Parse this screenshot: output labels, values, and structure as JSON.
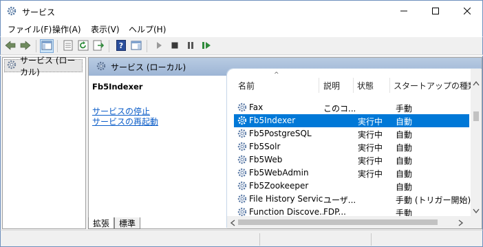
{
  "window": {
    "title": "サービス",
    "icon": "gear-icon",
    "controls": [
      "minimize-icon",
      "maximize-icon",
      "close-icon"
    ]
  },
  "menu": {
    "items": [
      {
        "label": "ファイル(F)"
      },
      {
        "label": "操作(A)"
      },
      {
        "label": "表示(V)"
      },
      {
        "label": "ヘルプ(H)"
      }
    ]
  },
  "toolbar": {
    "icons": [
      "back-icon",
      "forward-icon",
      "show-console-tree-icon",
      "properties-icon",
      "refresh-icon",
      "export-list-icon",
      "help-icon",
      "show-action-pane-icon",
      "play-icon",
      "stop-icon",
      "pause-icon",
      "restart-icon"
    ]
  },
  "tree": {
    "item_label": "サービス (ローカル)"
  },
  "pane": {
    "header": "サービス (ローカル)",
    "selected_service": "Fb5Indexer",
    "link_stop": "サービスの停止",
    "link_restart": "サービスの再起動"
  },
  "list": {
    "columns": [
      "名前",
      "説明",
      "状態",
      "スタートアップの種類"
    ],
    "rows": [
      {
        "name": "Fax",
        "desc": "このコ...",
        "state": "",
        "startup": "手動",
        "selected": false
      },
      {
        "name": "Fb5Indexer",
        "desc": "",
        "state": "実行中",
        "startup": "自動",
        "selected": true
      },
      {
        "name": "Fb5PostgreSQL",
        "desc": "",
        "state": "実行中",
        "startup": "自動",
        "selected": false
      },
      {
        "name": "Fb5Solr",
        "desc": "",
        "state": "実行中",
        "startup": "自動",
        "selected": false
      },
      {
        "name": "Fb5Web",
        "desc": "",
        "state": "実行中",
        "startup": "自動",
        "selected": false
      },
      {
        "name": "Fb5WebAdmin",
        "desc": "",
        "state": "実行中",
        "startup": "自動",
        "selected": false
      },
      {
        "name": "Fb5Zookeeper",
        "desc": "",
        "state": "",
        "startup": "自動",
        "selected": false
      },
      {
        "name": "File History Service",
        "desc": "ユーザ...",
        "state": "",
        "startup": "手動 (トリガー開始)",
        "selected": false
      },
      {
        "name": "Function Discove...",
        "desc": "FDP...",
        "state": "",
        "startup": "手動",
        "selected": false
      }
    ]
  },
  "tabs": [
    {
      "label": "拡張"
    },
    {
      "label": "標準"
    }
  ],
  "colors": {
    "selection": "#0078d7",
    "link": "#0a5cc8",
    "header_gradient": "#b8cbe2"
  }
}
